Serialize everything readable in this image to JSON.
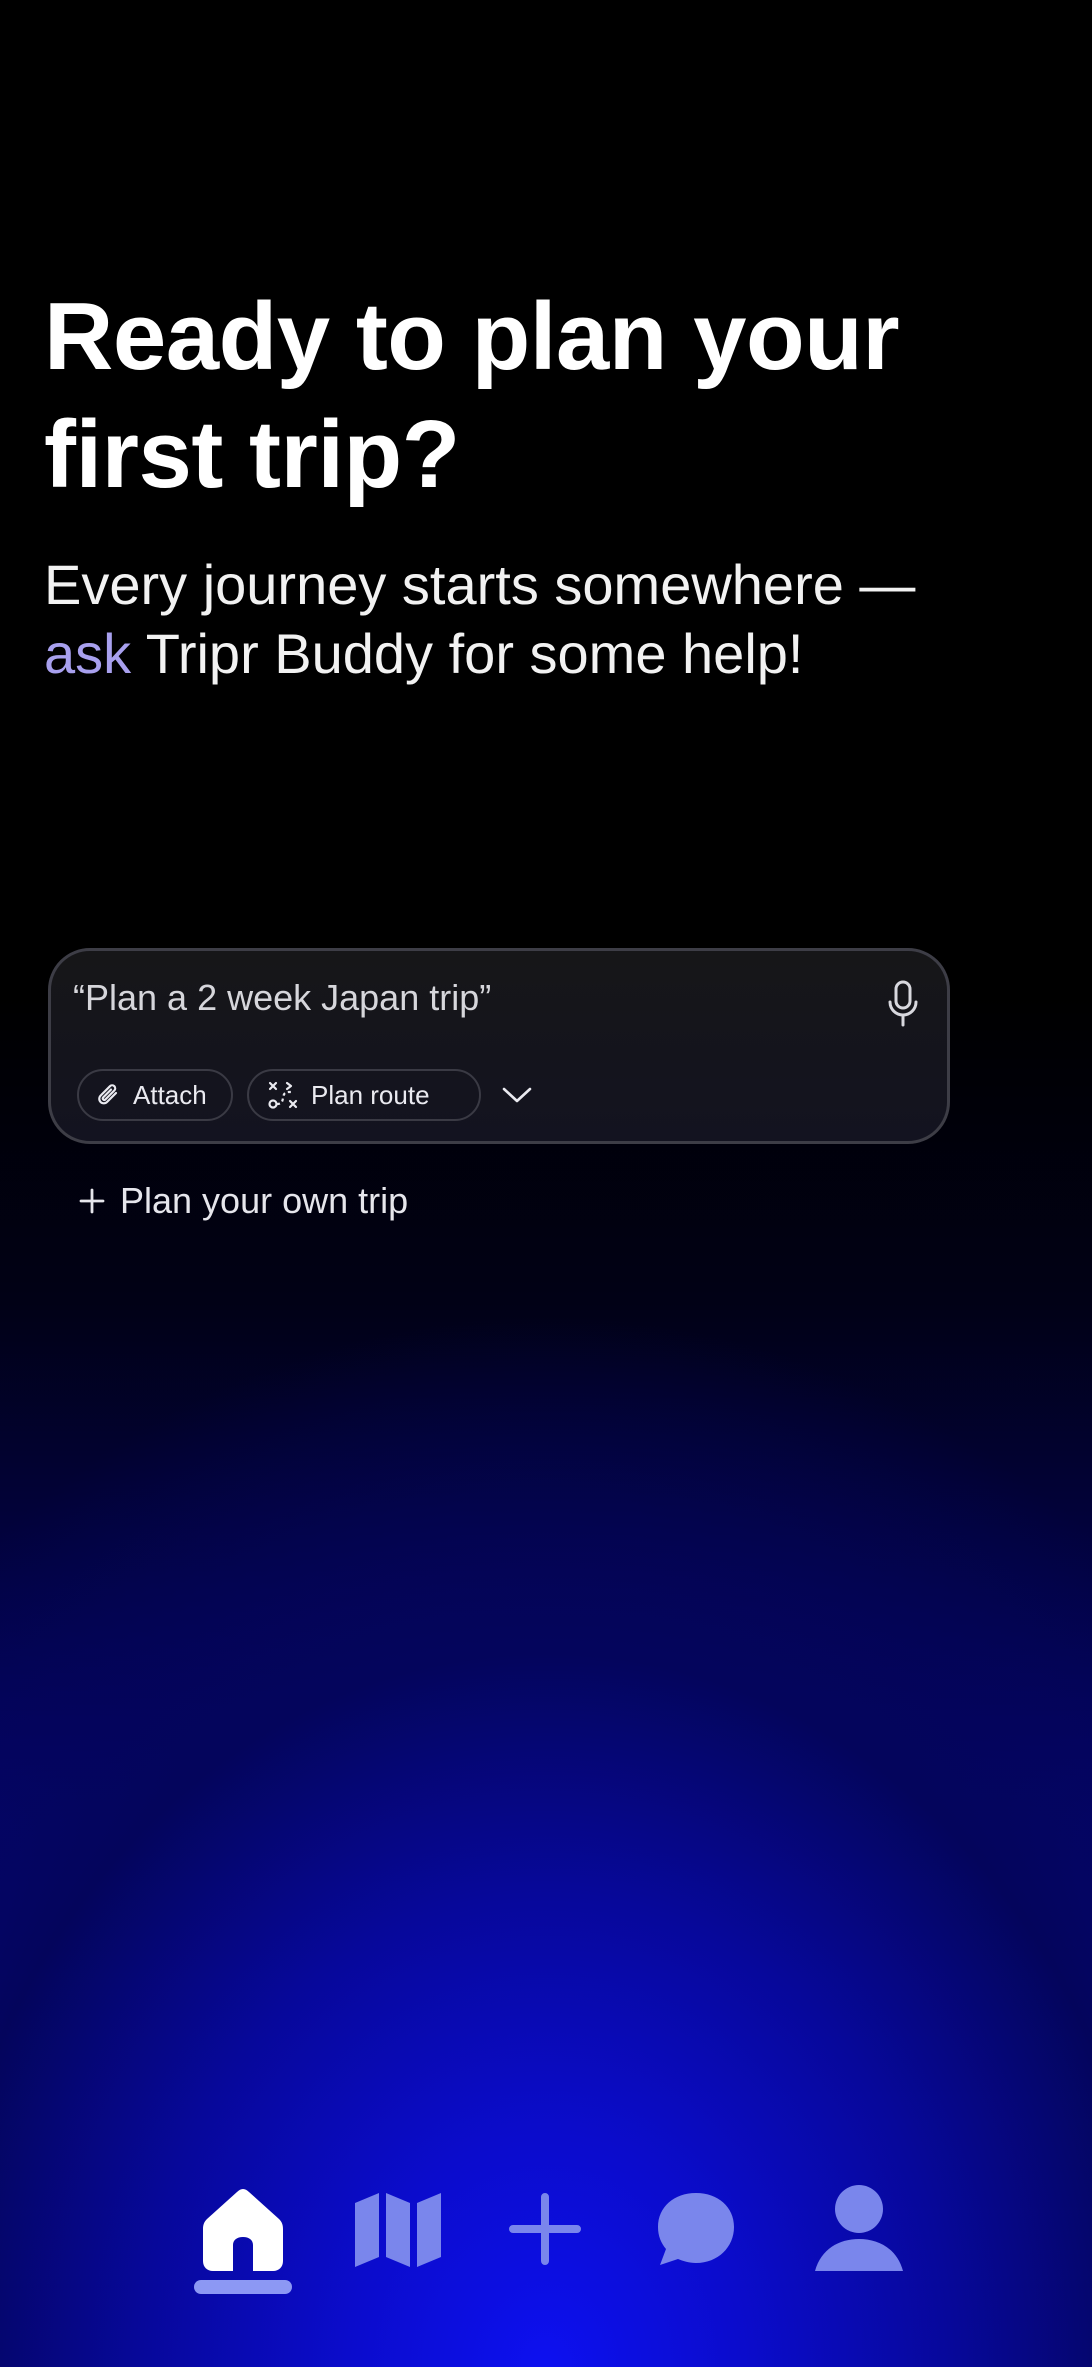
{
  "hero": {
    "title": "Ready to plan your first trip?",
    "subtitle_before": "Every journey starts somewhere — ",
    "subtitle_accent": "ask",
    "subtitle_after": " Tripr Buddy for some help!"
  },
  "prompt": {
    "input_value": "“Plan a 2 week Japan trip”",
    "attach_label": "Attach",
    "plan_route_label": "Plan route"
  },
  "own_trip_label": "Plan your own trip",
  "colors": {
    "accent": "#a8a0ee",
    "tab_active": "#ffffff",
    "tab_inactive": "#7a86ec",
    "indicator": "#8c98f4"
  },
  "tabs": [
    {
      "id": "home",
      "icon": "home-icon",
      "active": true
    },
    {
      "id": "trips",
      "icon": "map-icon",
      "active": false
    },
    {
      "id": "add",
      "icon": "plus-icon",
      "active": false
    },
    {
      "id": "chat",
      "icon": "chat-bubble-icon",
      "active": false
    },
    {
      "id": "profile",
      "icon": "profile-icon",
      "active": false
    }
  ]
}
